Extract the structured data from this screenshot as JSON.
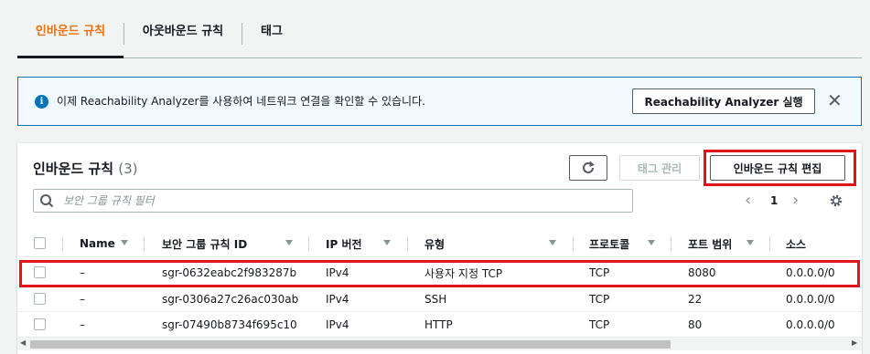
{
  "tabs": [
    {
      "label": "인바운드 규칙",
      "active": true
    },
    {
      "label": "아웃바운드 규칙",
      "active": false
    },
    {
      "label": "태그",
      "active": false
    }
  ],
  "banner": {
    "icon": "info-icon",
    "text": "이제 Reachability Analyzer를 사용하여 네트워크 연결을 확인할 수 있습니다.",
    "button_label": "Reachability Analyzer 실행",
    "close_icon": "close-icon"
  },
  "panel": {
    "title": "인바운드 규칙",
    "count": "(3)",
    "refresh_icon": "refresh-icon",
    "tag_button": "태그 관리",
    "edit_button": "인바운드 규칙 편집",
    "search_placeholder": "보안 그룹 규칙 필터",
    "page": "1"
  },
  "table": {
    "columns": [
      "Name",
      "보안 그룹 규칙 ID",
      "IP 버전",
      "유형",
      "프로토콜",
      "포트 범위",
      "소스"
    ],
    "rows": [
      {
        "name": "–",
        "rule_id": "sgr-0632eabc2f983287b",
        "ip_version": "IPv4",
        "type": "사용자 지정 TCP",
        "protocol": "TCP",
        "port_range": "8080",
        "source": "0.0.0.0/0"
      },
      {
        "name": "–",
        "rule_id": "sgr-0306a27c26ac030ab",
        "ip_version": "IPv4",
        "type": "SSH",
        "protocol": "TCP",
        "port_range": "22",
        "source": "0.0.0.0/0"
      },
      {
        "name": "–",
        "rule_id": "sgr-07490b8734f695c10",
        "ip_version": "IPv4",
        "type": "HTTP",
        "protocol": "TCP",
        "port_range": "80",
        "source": "0.0.0.0/0"
      }
    ]
  },
  "colors": {
    "accent": "#ec7211",
    "info_blue": "#0073bb",
    "highlight_red": "#e1141c"
  }
}
